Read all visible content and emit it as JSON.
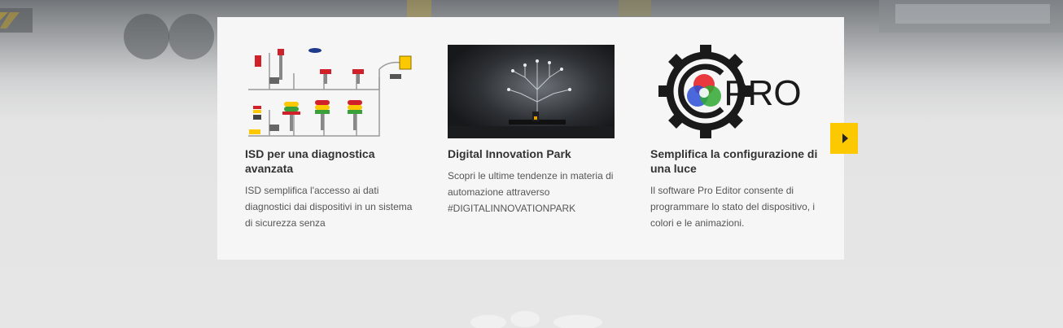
{
  "carousel": {
    "items": [
      {
        "title": "ISD per una diagnostica avanzata",
        "text": "ISD semplifica l'accesso ai dati diagnostici dai dispositivi in un sistema di sicurezza senza",
        "image": "isd-diagram"
      },
      {
        "title": "Digital Innovation Park",
        "text": "Scopri le ultime tendenze in materia di automazione attraverso #DIGITALINNOVATIONPARK",
        "image": "digital-tree-photo"
      },
      {
        "title": "Semplifica la configurazione di una luce",
        "text": "Il software Pro Editor consente di programmare lo stato del dispositivo, i colori e le animazioni.",
        "image": "pro-editor-logo",
        "logo_text": "PRO"
      }
    ],
    "next_icon": "chevron-right-icon"
  },
  "colors": {
    "accent": "#fcc800",
    "panel": "#f6f6f6",
    "title": "#333333",
    "text": "#555555"
  }
}
